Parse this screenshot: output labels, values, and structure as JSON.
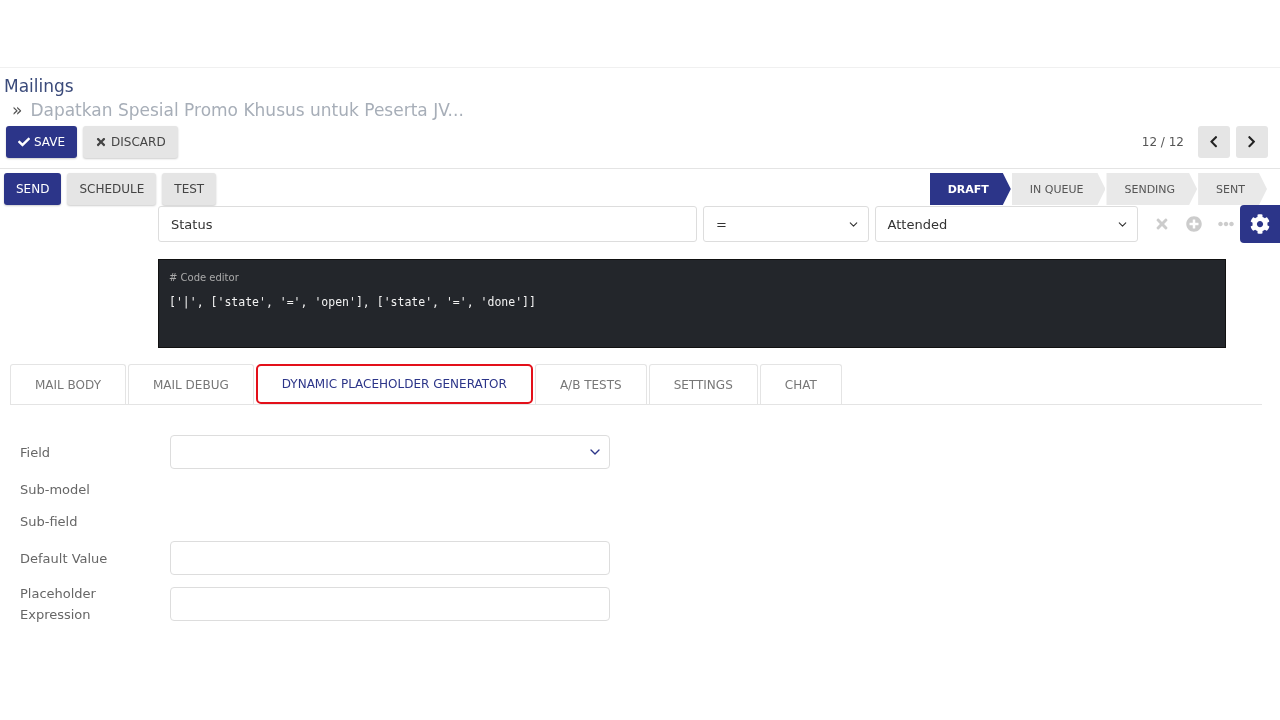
{
  "breadcrumb": {
    "parent": "Mailings",
    "separator": "»",
    "current": "Dapatkan Spesial Promo Khusus untuk Peserta JV..."
  },
  "actions": [
    {
      "label": "SAVE",
      "kind": "primary"
    },
    {
      "label": "DISCARD",
      "kind": "secondary"
    }
  ],
  "pager": {
    "text": "12 / 12"
  },
  "header_buttons": [
    {
      "label": "SEND",
      "kind": "primary"
    },
    {
      "label": "SCHEDULE",
      "kind": "secondary"
    },
    {
      "label": "TEST",
      "kind": "secondary"
    }
  ],
  "stages": [
    {
      "label": "DRAFT",
      "selected": true
    },
    {
      "label": "IN QUEUE",
      "selected": false
    },
    {
      "label": "SENDING",
      "selected": false
    },
    {
      "label": "SENT",
      "selected": false
    }
  ],
  "domain": {
    "field": "Status",
    "operator": "=",
    "value": "Attended"
  },
  "code_editor": {
    "caption": "# Code editor",
    "code": "['|', ['state', '=', 'open'], ['state', '=', 'done']]"
  },
  "tabs": [
    {
      "label": "MAIL BODY",
      "selected": false
    },
    {
      "label": "MAIL DEBUG",
      "selected": false
    },
    {
      "label": "DYNAMIC PLACEHOLDER GENERATOR",
      "selected": true
    },
    {
      "label": "A/B TESTS",
      "selected": false
    },
    {
      "label": "SETTINGS",
      "selected": false
    },
    {
      "label": "CHAT",
      "selected": false
    }
  ],
  "form": [
    {
      "label": "Field",
      "kind": "select"
    },
    {
      "label": "Sub-model",
      "kind": "none"
    },
    {
      "label": "Sub-field",
      "kind": "none"
    },
    {
      "label": "Default Value",
      "kind": "input"
    },
    {
      "label": "Placeholder Expression",
      "kind": "input"
    }
  ]
}
